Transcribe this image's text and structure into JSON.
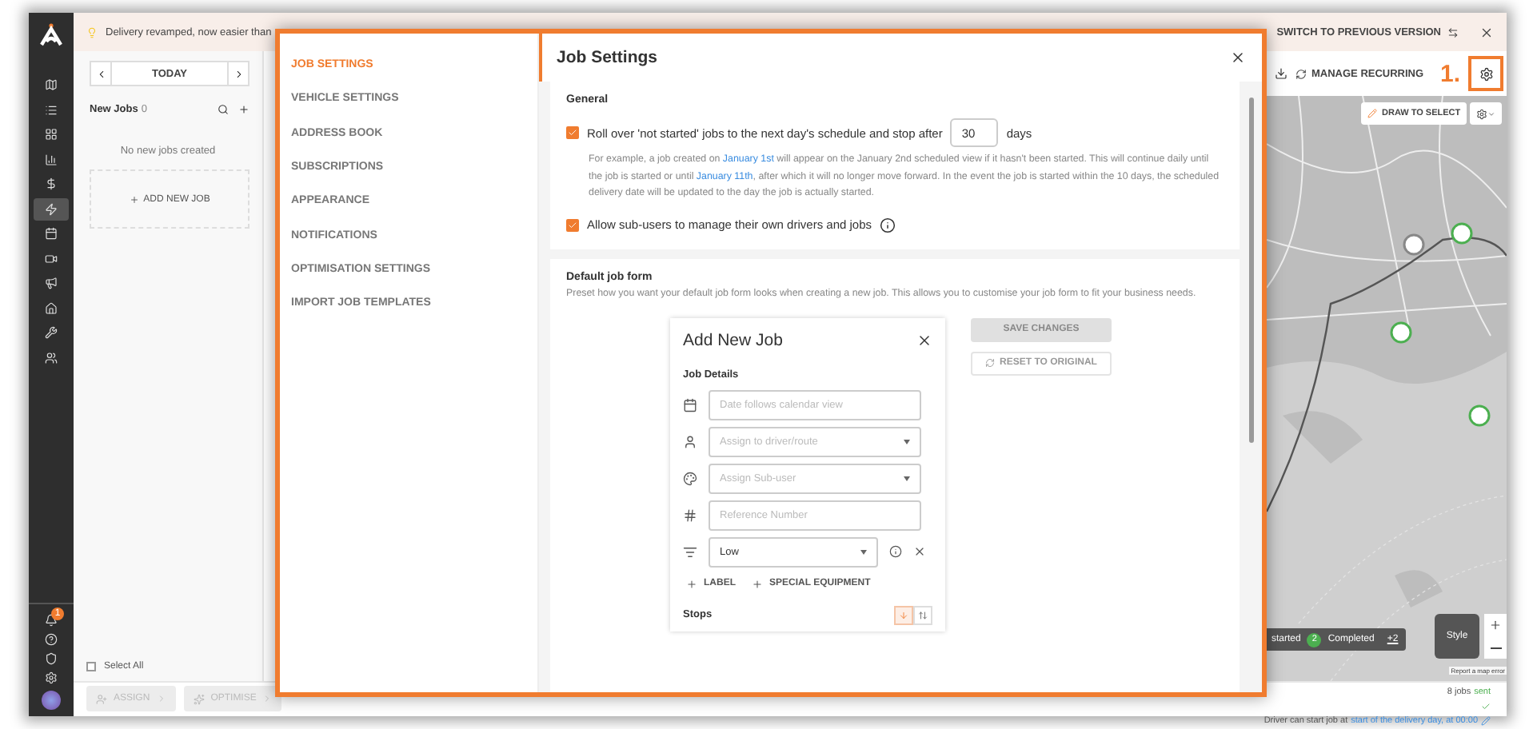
{
  "sidebar": {
    "items": [
      {
        "selected": false
      },
      {
        "selected": false
      },
      {
        "selected": false
      },
      {
        "selected": false
      },
      {
        "selected": false
      },
      {
        "selected": true
      },
      {
        "selected": false
      },
      {
        "selected": false
      },
      {
        "selected": false
      },
      {
        "selected": false
      },
      {
        "selected": false
      },
      {
        "selected": false
      }
    ],
    "notification_count": "1"
  },
  "banner": {
    "text": "Delivery revamped, now easier than",
    "switch_label": "SWITCH TO PREVIOUS VERSION"
  },
  "date_nav": {
    "label": "TODAY"
  },
  "new_jobs": {
    "title": "New Jobs",
    "count": "0",
    "empty_text": "No new jobs created",
    "add_label": "ADD NEW JOB",
    "select_all": {
      "label": "Select All",
      "checked": false
    }
  },
  "actions": [
    {
      "label": "ASSIGN",
      "disabled": true
    },
    {
      "label": "OPTIMISE",
      "disabled": true
    }
  ],
  "toolbar": {
    "manage_recurring": "MANAGE RECURRING",
    "annotation": "1."
  },
  "map": {
    "draw_label": "DRAW TO SELECT",
    "legend": [
      {
        "label": "started"
      },
      {
        "count": "2",
        "label": "Completed",
        "color": "#4caf50"
      }
    ],
    "more": "+2",
    "style_label": "Style",
    "report": "Report a map error"
  },
  "status": {
    "jobs_count": "8 jobs",
    "jobs_state": "sent",
    "driver_text": "Driver can start job at",
    "driver_link": "start of the delivery day, at 00:00"
  },
  "modal": {
    "nav": [
      {
        "label": "JOB SETTINGS",
        "selected": true
      },
      {
        "label": "VEHICLE SETTINGS",
        "selected": false
      },
      {
        "label": "ADDRESS BOOK",
        "selected": false
      },
      {
        "label": "SUBSCRIPTIONS",
        "selected": false
      },
      {
        "label": "APPEARANCE",
        "selected": false
      },
      {
        "label": "NOTIFICATIONS",
        "selected": false
      },
      {
        "label": "OPTIMISATION SETTINGS",
        "selected": false
      },
      {
        "label": "IMPORT JOB TEMPLATES",
        "selected": false
      }
    ],
    "title": "Job Settings",
    "general": {
      "heading": "General",
      "rollover": {
        "checked": true,
        "label": "Roll over 'not started' jobs to the next day's schedule and stop after",
        "days": "30",
        "unit": "days",
        "help": [
          {
            "kind": "text",
            "text": "For example, a job created on "
          },
          {
            "kind": "link",
            "text": "January 1st"
          },
          {
            "kind": "text",
            "text": " will appear on the January 2nd scheduled view if it hasn't been started. This will continue daily until the job is started or until "
          },
          {
            "kind": "link",
            "text": "January 11th"
          },
          {
            "kind": "text",
            "text": ", after which it will no longer move forward. In the event the job is started within the 10 days, the scheduled delivery date will be updated to the day the job is actually started."
          }
        ]
      },
      "sub_users": {
        "checked": true,
        "label": "Allow sub-users to manage their own drivers and jobs"
      }
    },
    "form_section": {
      "heading": "Default job form",
      "description": "Preset how you want your default job form looks when creating a new job. This allows you to customise your job form to fit your business needs.",
      "preview": {
        "title": "Add New Job",
        "section": "Job Details",
        "fields": [
          {
            "kind": "input",
            "placeholder": "Date follows calendar view"
          },
          {
            "kind": "select",
            "placeholder": "Assign to driver/route"
          },
          {
            "kind": "select",
            "placeholder": "Assign Sub-user"
          },
          {
            "kind": "input",
            "placeholder": "Reference Number"
          },
          {
            "kind": "priority",
            "value": "Low"
          }
        ],
        "add_buttons": [
          "LABEL",
          "SPECIAL EQUIPMENT"
        ],
        "stops": "Stops",
        "sort_options": [
          {
            "selected": true
          },
          {
            "selected": false
          }
        ]
      },
      "save": {
        "label": "SAVE CHANGES",
        "disabled": true
      },
      "reset": {
        "label": "RESET TO ORIGINAL",
        "disabled": true
      }
    }
  }
}
